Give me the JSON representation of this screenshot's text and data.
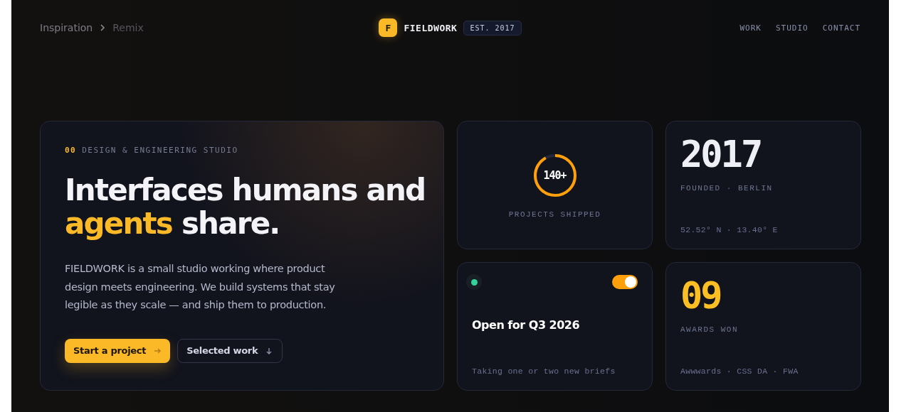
{
  "breadcrumb": [
    {
      "label": "Inspiration",
      "current": false
    },
    {
      "label": "Remix",
      "current": true
    }
  ],
  "brand": {
    "mark": "F",
    "name": "FIELDWORK",
    "badge": "EST. 2017"
  },
  "nav": [
    "WORK",
    "STUDIO",
    "CONTACT"
  ],
  "hero": {
    "index": "00",
    "eyebrow": "DESIGN & ENGINEERING STUDIO",
    "title_line1": "Interfaces humans and",
    "title_accent": "agents",
    "title_rest": "share.",
    "body": "FIELDWORK is a small studio working where product design meets engineering. We build systems that stay legible as they scale — and ship them to production.",
    "primary": "Start a project",
    "secondary": "Selected work"
  },
  "projects": {
    "value": "140+",
    "label": "PROJECTS SHIPPED"
  },
  "founded": {
    "value": "2017",
    "label": "FOUNDED · BERLIN",
    "coords": "52.52° N · 13.40° E"
  },
  "availability": {
    "color": "#34d399",
    "on": true,
    "title": "Open for Q3 2026",
    "note": "Taking one or two new briefs"
  },
  "awards": {
    "value": "09",
    "label": "AWARDS WON",
    "list": "Awwwards · CSS DA · FWA"
  }
}
